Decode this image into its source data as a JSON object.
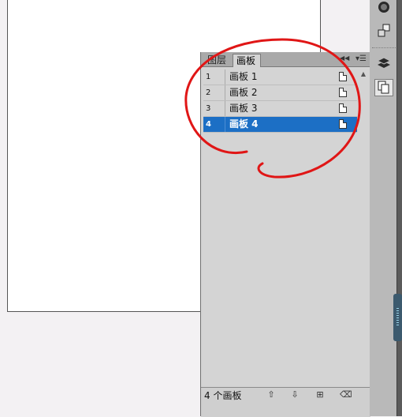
{
  "panel": {
    "tabs": [
      {
        "label": "图层",
        "active": false
      },
      {
        "label": "画板",
        "active": true
      }
    ],
    "collapse_icon": "double-chevron-right-icon",
    "menu_icon": "panel-menu-icon",
    "artboards": [
      {
        "number": "1",
        "name": "画板 1",
        "selected": false
      },
      {
        "number": "2",
        "name": "画板 2",
        "selected": false
      },
      {
        "number": "3",
        "name": "画板 3",
        "selected": false
      },
      {
        "number": "4",
        "name": "画板 4",
        "selected": true
      }
    ],
    "status": {
      "count_label": "4 个画板",
      "buttons": [
        "move-up-icon",
        "move-down-icon",
        "new-artboard-icon",
        "delete-artboard-icon"
      ]
    }
  },
  "dock": {
    "icons": [
      "color-icon",
      "transform-icon",
      "layers-icon",
      "artboards-icon"
    ]
  },
  "colors": {
    "selection": "#1c6fc5",
    "annotation": "#e01616",
    "panel_bg": "#d4d4d4"
  }
}
